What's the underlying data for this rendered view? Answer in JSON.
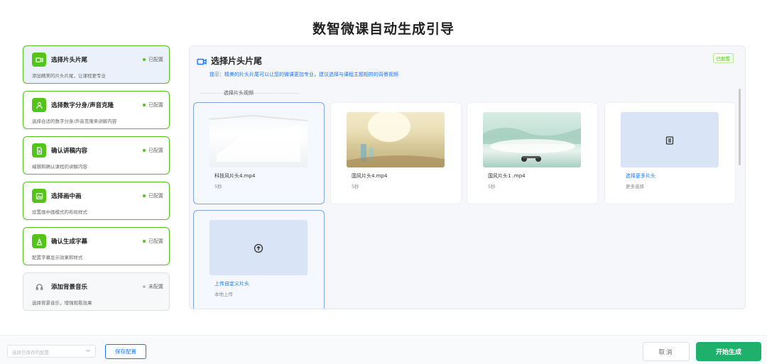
{
  "page": {
    "title": "数智微课自动生成引导"
  },
  "steps": [
    {
      "title": "选择片头片尾",
      "status": "已配置",
      "desc": "添加精美的片头片尾，让课程更专业",
      "icon": "video-icon"
    },
    {
      "title": "选择数字分身/声音克隆",
      "status": "已配置",
      "desc": "选择合适的数字分身/声音克隆来讲解内容",
      "icon": "user-icon"
    },
    {
      "title": "确认讲稿内容",
      "status": "已配置",
      "desc": "编辑和确认课程的讲解内容",
      "icon": "document-icon"
    },
    {
      "title": "选择画中画",
      "status": "已配置",
      "desc": "设置画中画模式的布局样式",
      "icon": "image-icon"
    },
    {
      "title": "确认生成字幕",
      "status": "已配置",
      "desc": "配置字幕显示效果和样式",
      "icon": "subtitle-icon"
    },
    {
      "title": "添加背景音乐",
      "status": "未配置",
      "desc": "选择背景音乐，增强观看效果",
      "icon": "headphones-icon"
    }
  ],
  "panel": {
    "title": "选择片头片尾",
    "tag": "已配置",
    "tip": "提示：精美的片头片尾可以让您的微课更加专业，建议选择与课程主题相符的背景视频",
    "section_label": "选择片头视频",
    "cards": [
      {
        "name": "科技风片头4.mp4",
        "sub": "5秒"
      },
      {
        "name": "国风片头4.mp4",
        "sub": "5秒"
      },
      {
        "name": "国风片头1 .mp4",
        "sub": "5秒"
      },
      {
        "name": "选择更多片头",
        "sub": "更多选择"
      },
      {
        "name": "上传自定义片头",
        "sub": "本地上传"
      }
    ]
  },
  "footer": {
    "select_placeholder": "选择已保存的配置",
    "save_label": "保存配置",
    "cancel_label": "取消",
    "start_label": "开始生成"
  },
  "colors": {
    "accent": "#1677ff",
    "success": "#52c41a",
    "primary_button": "#1fb06b"
  }
}
